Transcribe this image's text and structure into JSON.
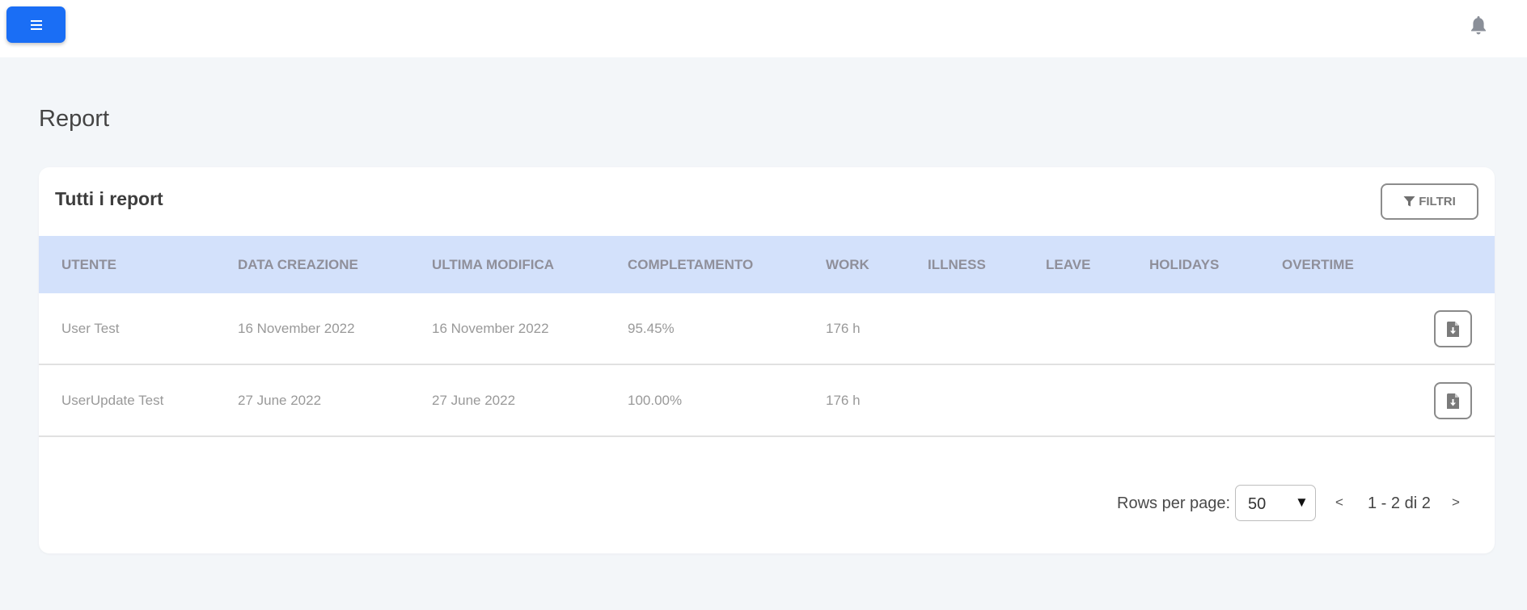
{
  "header": {
    "menu_icon": "hamburger-menu-icon",
    "bell_icon": "bell-icon",
    "accent_color": "#1a6ef5"
  },
  "page": {
    "title": "Report"
  },
  "card": {
    "title": "Tutti i report",
    "filter_label": "FILTRI",
    "filter_icon": "filter-funnel-icon"
  },
  "table": {
    "header_bg": "#d3e1fb",
    "columns": [
      "UTENTE",
      "DATA CREAZIONE",
      "ULTIMA MODIFICA",
      "COMPLETAMENTO",
      "WORK",
      "ILLNESS",
      "LEAVE",
      "HOLIDAYS",
      "OVERTIME"
    ],
    "rows": [
      {
        "utente": "User Test",
        "data_creazione": "16 November 2022",
        "ultima_modifica": "16 November 2022",
        "completamento": "95.45%",
        "work": "176 h",
        "illness": "",
        "leave": "",
        "holidays": "",
        "overtime": "",
        "action_icon": "file-download-icon"
      },
      {
        "utente": "UserUpdate Test",
        "data_creazione": "27 June 2022",
        "ultima_modifica": "27 June 2022",
        "completamento": "100.00%",
        "work": "176 h",
        "illness": "",
        "leave": "",
        "holidays": "",
        "overtime": "",
        "action_icon": "file-download-icon"
      }
    ]
  },
  "pagination": {
    "rows_per_page_label": "Rows per page:",
    "rows_per_page_value": "50",
    "prev_label": "<",
    "range_label": "1 - 2 di 2",
    "next_label": ">"
  }
}
